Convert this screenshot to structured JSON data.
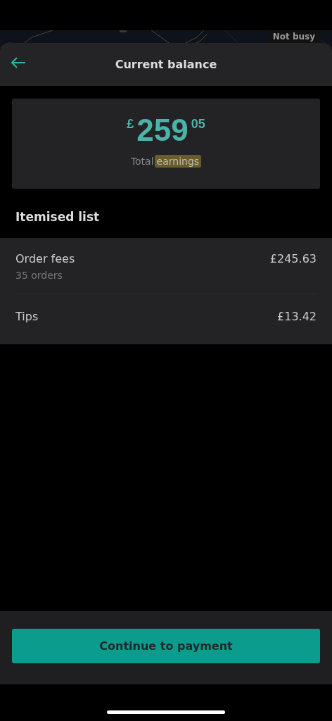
{
  "map_strip": {
    "badge": "Not busy"
  },
  "header": {
    "title": "Current balance"
  },
  "balance": {
    "currency": "£",
    "whole": "259",
    "fraction": "05",
    "caption": "Total",
    "caption_highlight": "earnings"
  },
  "section_title": "Itemised list",
  "items": [
    {
      "label": "Order fees",
      "detail": "35 orders",
      "amount": "£245.63"
    },
    {
      "label": "Tips",
      "amount": "£13.42"
    }
  ],
  "primary_button": "Continue to payment"
}
